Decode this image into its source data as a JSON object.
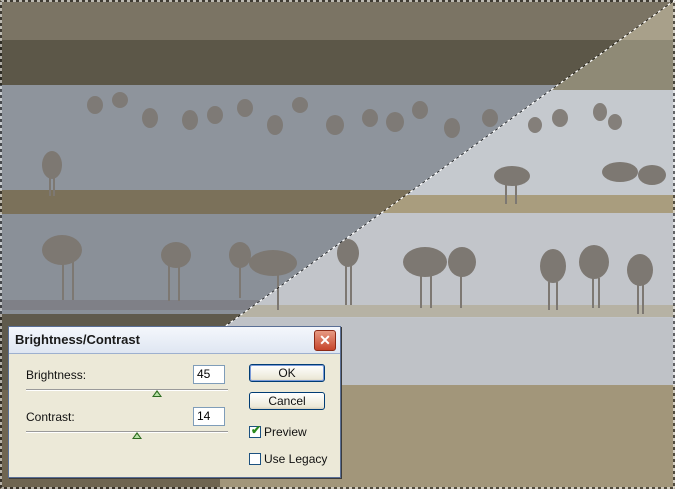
{
  "dialog": {
    "title": "Brightness/Contrast",
    "close_glyph": "✕",
    "brightness": {
      "label": "Brightness:",
      "value": "45",
      "slider_fraction": 0.65
    },
    "contrast": {
      "label": "Contrast:",
      "value": "14",
      "slider_fraction": 0.55
    },
    "ok_label": "OK",
    "cancel_label": "Cancel",
    "preview": {
      "label": "Preview",
      "checked": true
    },
    "use_legacy": {
      "label": "Use Legacy",
      "checked": false
    }
  },
  "colors": {
    "water": "#8e949c",
    "water_bright": "#c7cacf",
    "grass": "#7a7460",
    "grass_bright": "#a69a78"
  }
}
